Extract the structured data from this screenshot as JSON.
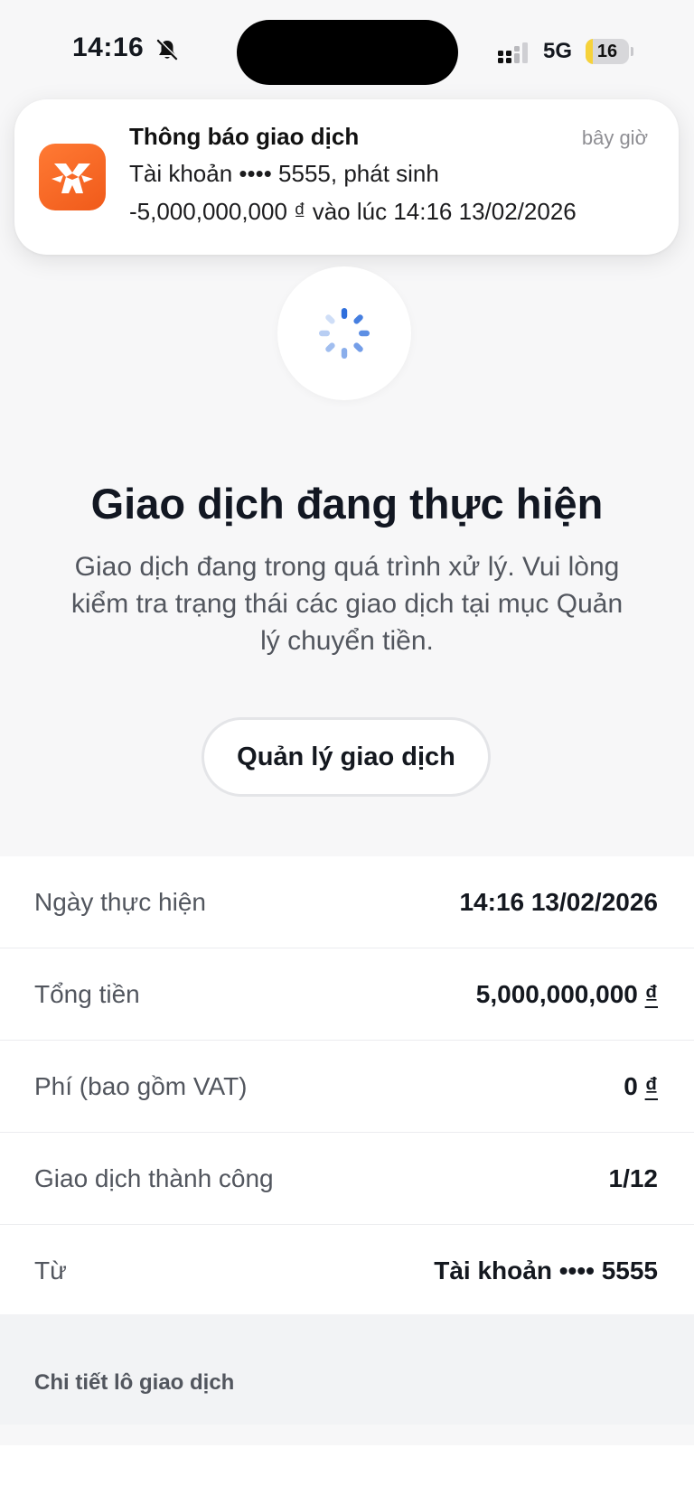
{
  "status_bar": {
    "time": "14:16",
    "network": "5G",
    "battery_level": "16",
    "battery_fraction": 0.16,
    "icons": [
      "bell-slash-icon",
      "signal-icon",
      "battery-icon"
    ]
  },
  "notification": {
    "title": "Thông báo giao dịch",
    "time": "bây giờ",
    "line1": "Tài khoản •••• 5555, phát sinh",
    "line2": "-5,000,000,000 ₫ vào lúc 14:16 13/02/2026",
    "accent_color": "#f26522"
  },
  "result": {
    "title": "Giao dịch đang thực hiện",
    "description": "Giao dịch đang trong quá trình xử lý. Vui lòng kiểm tra trạng thái các giao dịch tại mục Quản lý chuyển tiền.",
    "button_label": "Quản lý giao dịch",
    "spinner_color": "#2f6fdc"
  },
  "details": [
    {
      "label": "Ngày thực hiện",
      "value": "14:16 13/02/2026"
    },
    {
      "label": "Tổng tiền",
      "value": "5,000,000,000",
      "currency": "₫"
    },
    {
      "label": "Phí (bao gồm VAT)",
      "value": "0",
      "currency": "₫"
    },
    {
      "label": "Giao dịch thành công",
      "value": "1/12"
    },
    {
      "label": "Từ",
      "value": "Tài khoản •••• 5555"
    }
  ],
  "batch": {
    "title": "Chi tiết lô giao dịch"
  }
}
